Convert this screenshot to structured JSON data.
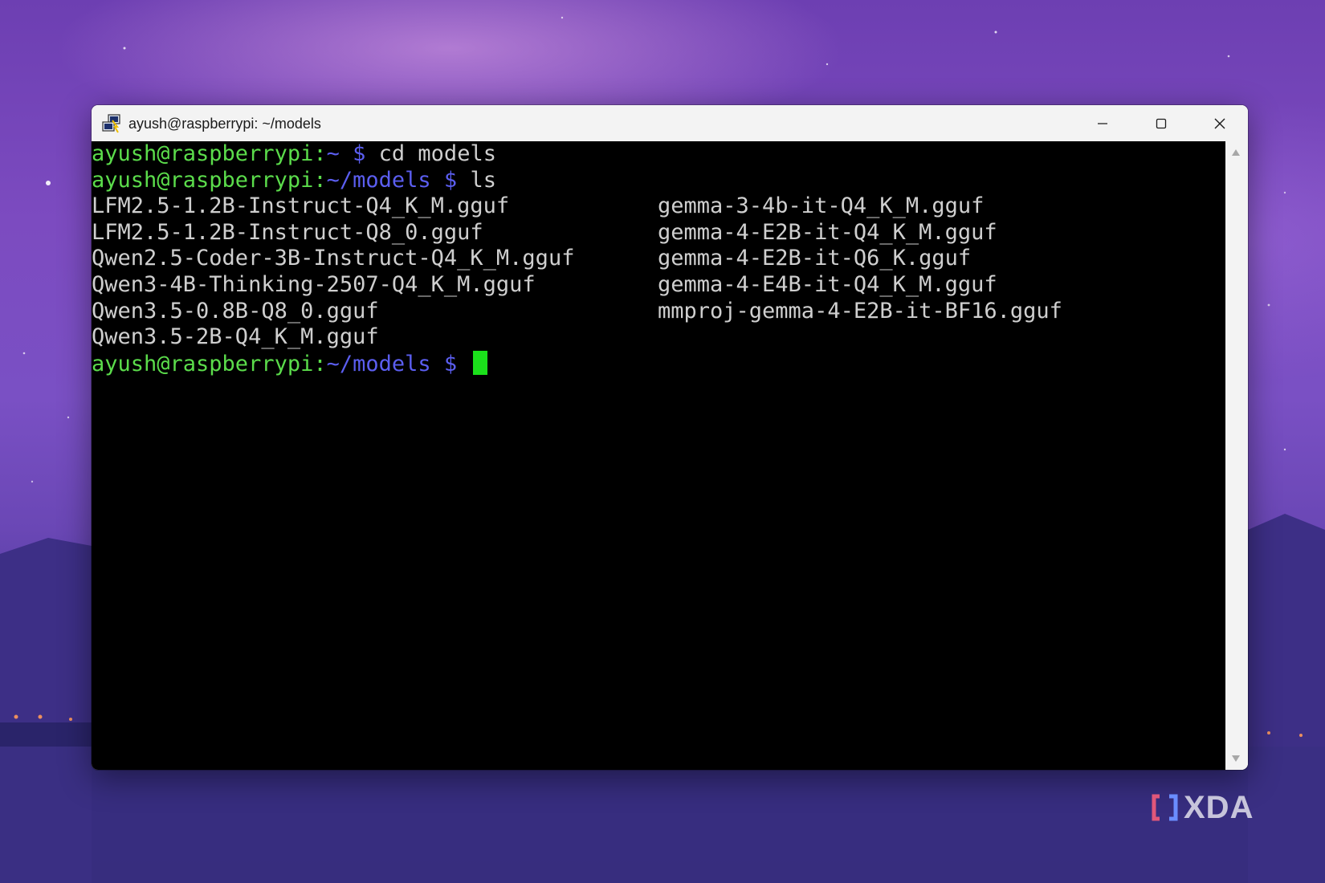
{
  "window": {
    "title": "ayush@raspberrypi: ~/models",
    "controls": {
      "minimize": "minimize-icon",
      "maximize": "maximize-icon",
      "close": "close-icon"
    }
  },
  "terminal": {
    "prompt1": {
      "user": "ayush@raspberrypi",
      "sep": ":",
      "path": "~",
      "dollar": " $ ",
      "command": "cd models"
    },
    "prompt2": {
      "user": "ayush@raspberrypi",
      "sep": ":",
      "path": "~/models",
      "dollar": " $ ",
      "command": "ls"
    },
    "files_col1": [
      "LFM2.5-1.2B-Instruct-Q4_K_M.gguf",
      "LFM2.5-1.2B-Instruct-Q8_0.gguf",
      "Qwen2.5-Coder-3B-Instruct-Q4_K_M.gguf",
      "Qwen3-4B-Thinking-2507-Q4_K_M.gguf",
      "Qwen3.5-0.8B-Q8_0.gguf",
      "Qwen3.5-2B-Q4_K_M.gguf"
    ],
    "files_col2": [
      "gemma-3-4b-it-Q4_K_M.gguf",
      "gemma-4-E2B-it-Q4_K_M.gguf",
      "gemma-4-E2B-it-Q6_K.gguf",
      "gemma-4-E4B-it-Q4_K_M.gguf",
      "mmproj-gemma-4-E2B-it-BF16.gguf"
    ],
    "prompt3": {
      "user": "ayush@raspberrypi",
      "sep": ":",
      "path": "~/models",
      "dollar": " $ "
    }
  },
  "colors": {
    "prompt_user": "#5bdc4b",
    "prompt_path": "#5b5ef0",
    "text": "#cfcfcf",
    "cursor": "#1be01b",
    "terminal_bg": "#000000"
  },
  "watermark": {
    "text": "XDA"
  }
}
